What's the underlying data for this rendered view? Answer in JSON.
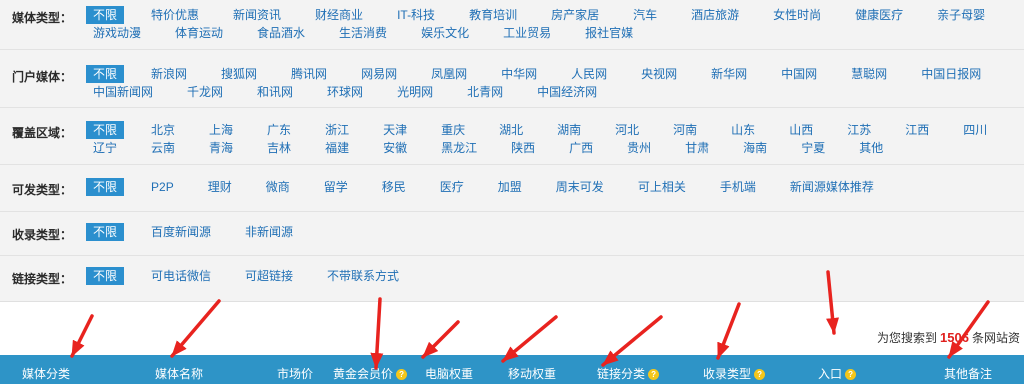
{
  "filters": [
    {
      "label": "媒体类型：",
      "selected_index": 0,
      "options": [
        "不限",
        "特价优惠",
        "新闻资讯",
        "财经商业",
        "IT-科技",
        "教育培训",
        "房产家居",
        "汽车",
        "酒店旅游",
        "女性时尚",
        "健康医疗",
        "亲子母婴",
        "游戏动漫",
        "体育运动",
        "食品酒水",
        "生活消费",
        "娱乐文化",
        "工业贸易",
        "报社官媒"
      ]
    },
    {
      "label": "门户媒体：",
      "selected_index": 0,
      "options": [
        "不限",
        "新浪网",
        "搜狐网",
        "腾讯网",
        "网易网",
        "凤凰网",
        "中华网",
        "人民网",
        "央视网",
        "新华网",
        "中国网",
        "慧聪网",
        "中国日报网",
        "中国新闻网",
        "千龙网",
        "和讯网",
        "环球网",
        "光明网",
        "北青网",
        "中国经济网"
      ]
    },
    {
      "label": "覆盖区域：",
      "selected_index": 0,
      "options": [
        "不限",
        "北京",
        "上海",
        "广东",
        "浙江",
        "天津",
        "重庆",
        "湖北",
        "湖南",
        "河北",
        "河南",
        "山东",
        "山西",
        "江苏",
        "江西",
        "四川",
        "辽宁",
        "云南",
        "青海",
        "吉林",
        "福建",
        "安徽",
        "黑龙江",
        "陕西",
        "广西",
        "贵州",
        "甘肃",
        "海南",
        "宁夏",
        "其他"
      ]
    },
    {
      "label": "可发类型：",
      "selected_index": 0,
      "options": [
        "不限",
        "P2P",
        "理财",
        "微商",
        "留学",
        "移民",
        "医疗",
        "加盟",
        "周末可发",
        "可上相关",
        "手机端",
        "新闻源媒体推荐"
      ]
    },
    {
      "label": "收录类型：",
      "selected_index": 0,
      "options": [
        "不限",
        "百度新闻源",
        "非新闻源"
      ]
    },
    {
      "label": "链接类型：",
      "selected_index": 0,
      "options": [
        "不限",
        "可电话微信",
        "可超链接",
        "不带联系方式"
      ]
    }
  ],
  "result": {
    "prefix": "为您搜索到",
    "count": "1506",
    "suffix": "条网站资"
  },
  "table_header": [
    {
      "label": "媒体分类"
    },
    {
      "label": "媒体名称"
    },
    {
      "label": "市场价"
    },
    {
      "label": "黄金会员价",
      "icon": "help-icon"
    },
    {
      "label": "电脑权重"
    },
    {
      "label": "移动权重"
    },
    {
      "label": "链接分类",
      "icon": "help-icon"
    },
    {
      "label": "收录类型",
      "icon": "help-icon"
    },
    {
      "label": "入口",
      "icon": "help-icon"
    },
    {
      "label": "其他备注"
    }
  ],
  "colors": {
    "option_blue": "#1f6fb5",
    "selected_blue": "#2b8fce",
    "header_blue": "#2e94c7",
    "count_red": "#e0201e",
    "arrow_red": "#e8231f",
    "help_yellow": "#f4c61a"
  }
}
